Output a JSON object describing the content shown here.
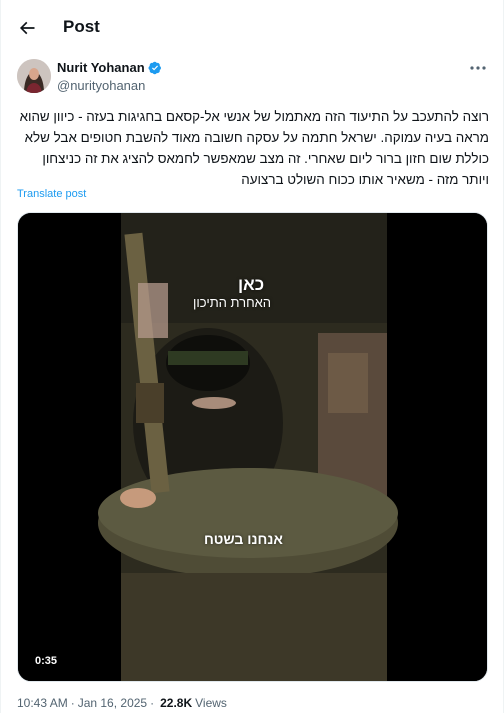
{
  "header": {
    "title": "Post",
    "back_icon": "arrow-left-icon"
  },
  "author": {
    "name": "Nurit Yohanan",
    "handle": "@nurityohanan",
    "verified_icon": "verified-badge-icon",
    "verified_color": "#1d9bf0"
  },
  "post": {
    "text": "רוצה להתעכב על התיעוד הזה מאתמול של אנשי אל-קסאם בחגיגות בעזה - כיוון שהוא מראה בעיה עמוקה. ישראל חתמה על עסקה חשובה מאוד להשבת חטופים אבל שלא כוללת שום חזון ברור ליום שאחרי. זה מצב שמאפשר לחמאס להציג את זה כניצחון ויותר מזה - משאיר אותו ככוח השולט ברצועה",
    "translate_label": "Translate post"
  },
  "media": {
    "overlay_logo": "כאן",
    "overlay_sub": "האחרת התיכון",
    "caption": "אנחנו בשטח",
    "duration": "0:35"
  },
  "meta": {
    "time": "10:43 AM",
    "date": "Jan 16, 2025",
    "views_count": "22.8K",
    "views_label": "Views"
  },
  "colors": {
    "link": "#1d9bf0",
    "secondary_text": "#536471"
  }
}
